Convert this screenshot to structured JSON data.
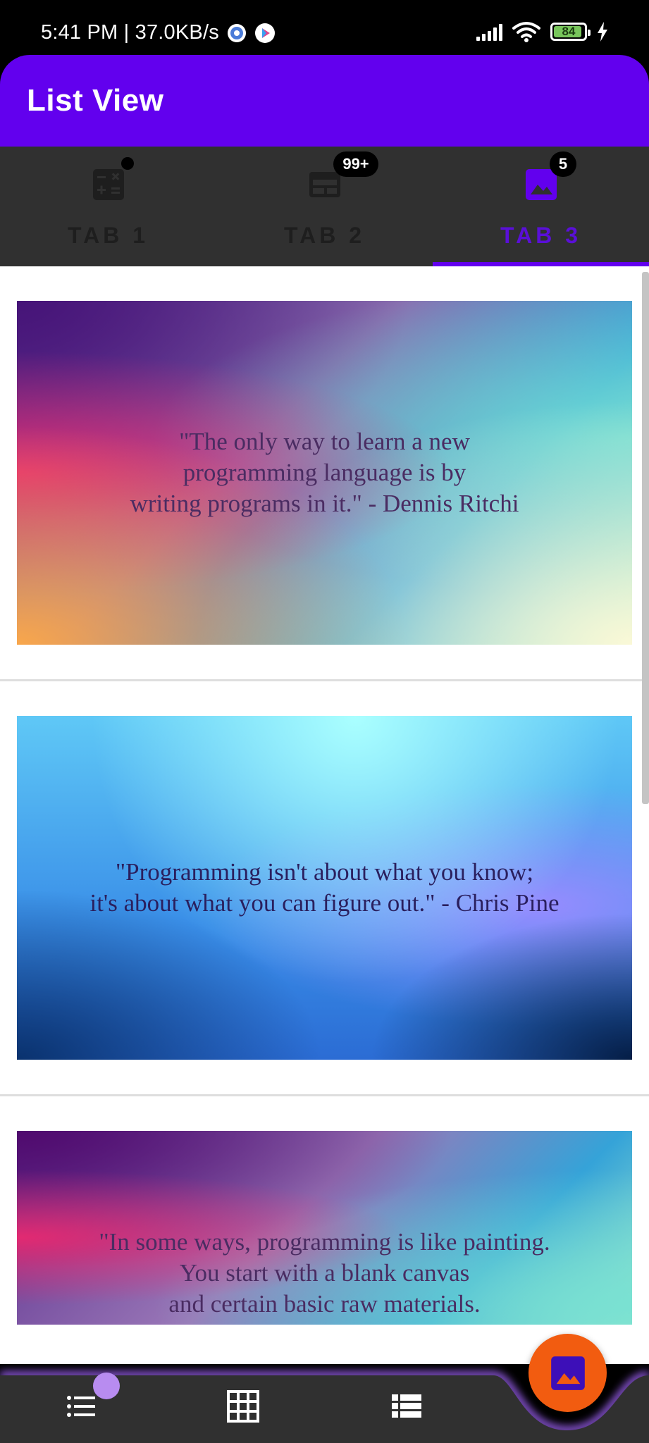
{
  "status_bar": {
    "time_speed": "5:41 PM | 37.0KB/s",
    "battery_level": "84",
    "icons": [
      "settings-gear-icon",
      "play-store-icon",
      "signal-icon",
      "wifi-icon",
      "battery-icon",
      "charging-icon"
    ]
  },
  "app_bar": {
    "title": "List View"
  },
  "tabs": [
    {
      "label": "TAB 1",
      "icon": "calculator-icon",
      "badge": "dot"
    },
    {
      "label": "TAB 2",
      "icon": "web-layout-icon",
      "badge": "99+"
    },
    {
      "label": "TAB 3",
      "icon": "image-icon",
      "badge": "5",
      "active": true
    }
  ],
  "list": {
    "items": [
      {
        "quote": "\"The only way to learn a new\nprogramming language is by\nwriting programs in it.\" - Dennis Ritchi"
      },
      {
        "quote": "\"Programming isn't about what you know;\nit's about what you can figure out.\" - Chris Pine"
      },
      {
        "quote": "\"In some ways, programming is like painting.\nYou start with a blank canvas\nand certain basic raw materials."
      }
    ]
  },
  "bottom_nav": {
    "items": [
      {
        "icon": "list-icon",
        "has_badge": true
      },
      {
        "icon": "grid-icon"
      },
      {
        "icon": "view-list-icon"
      }
    ],
    "fab_icon": "image-icon"
  },
  "colors": {
    "primary": "#6200ee",
    "tab_bar": "#303030",
    "fab": "#f25c10",
    "badge": "#000000",
    "nav_badge": "#b88cf0"
  }
}
